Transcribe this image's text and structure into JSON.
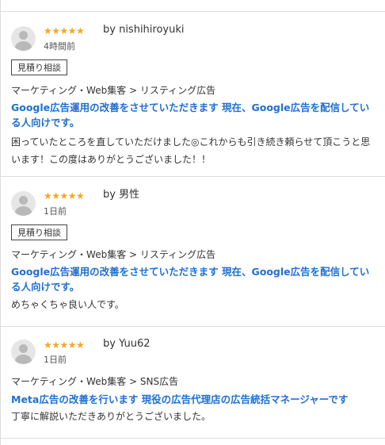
{
  "reviews": [
    {
      "stars": "★★★★★",
      "by_label": "by nishihiroyuki",
      "time_ago": "4時間前",
      "tag": "見積り相談",
      "category": "マーケティング・Web集客 > リスティング広告",
      "service_title": "Google広告運用の改善をさせていただきます 現在、Google広告を配信している人向けです。",
      "comment": "困っていたところを直していただけました◎これからも引き続き頼らせて頂こうと思います！この度はありがとうございました！！"
    },
    {
      "stars": "★★★★★",
      "by_label": "by 男性",
      "time_ago": "1日前",
      "tag": "見積り相談",
      "category": "マーケティング・Web集客 > リスティング広告",
      "service_title": "Google広告運用の改善をさせていただきます 現在、Google広告を配信している人向けです。",
      "comment": "めちゃくちゃ良い人です。"
    },
    {
      "stars": "★★★★★",
      "by_label": "by Yuu62",
      "time_ago": "1日前",
      "category": "マーケティング・Web集客 > SNS広告",
      "service_title": "Meta広告の改善を行います 現役の広告代理店の広告統括マネージャーです",
      "comment": "丁寧に解説いただきありがとうございました。"
    }
  ],
  "colors": {
    "star": "#f6a623",
    "link": "#1f6fd1",
    "divider": "#dcdcdc"
  },
  "icons": {
    "avatar": "user-avatar-icon",
    "star": "star-icon"
  }
}
